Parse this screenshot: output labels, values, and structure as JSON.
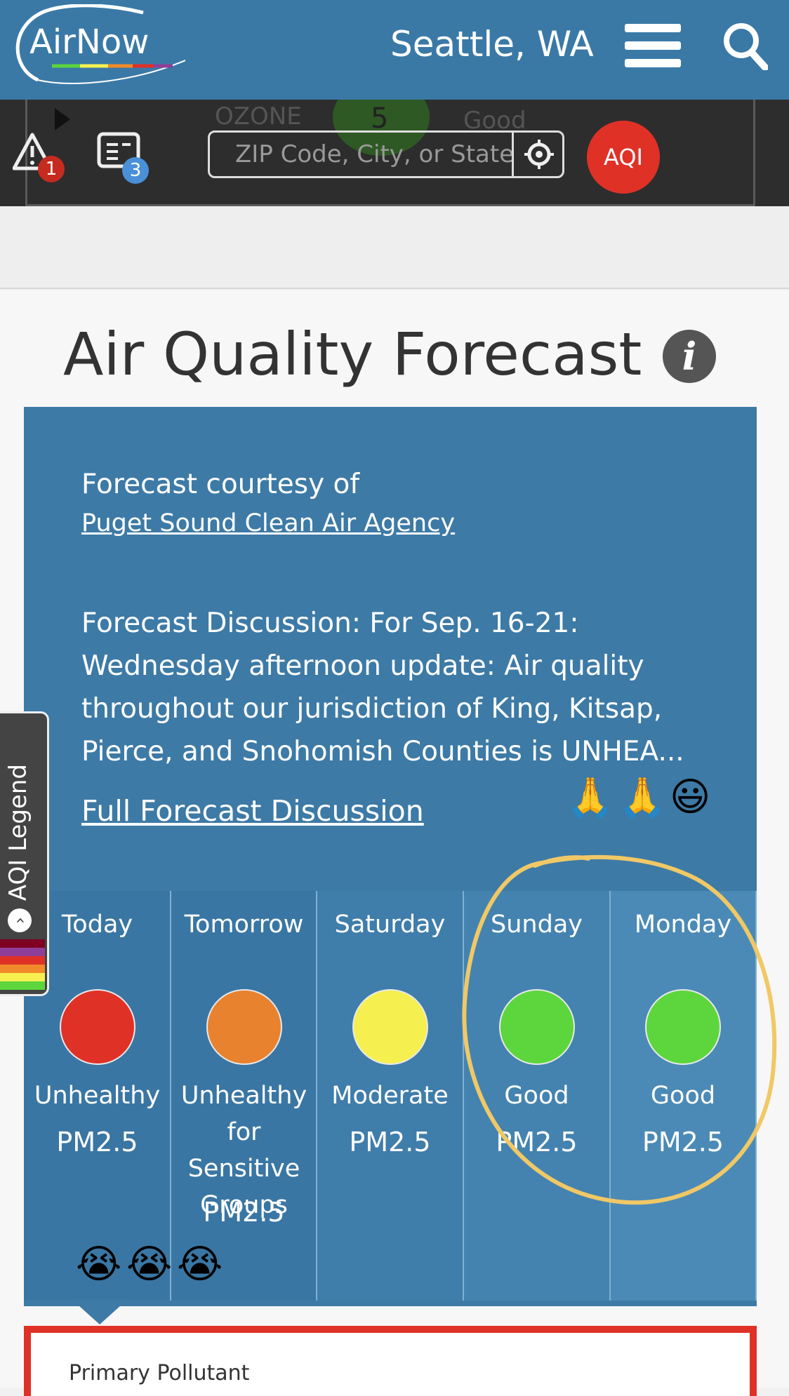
{
  "header": {
    "logo_text": "AirNow",
    "location": "Seattle, WA"
  },
  "toolbar": {
    "ghost_pollutant": "OZONE",
    "ghost_value": "5",
    "ghost_status": "Good",
    "alerts_count": "1",
    "reports_count": "3",
    "search_placeholder": "ZIP Code, City, or State",
    "aqi_button": "AQI"
  },
  "forecast": {
    "title": "Air Quality Forecast",
    "courtesy_label": "Forecast courtesy of",
    "agency_name": "Puget Sound Clean Air Agency",
    "discussion": "Forecast Discussion: For Sep. 16-21: Wednesday afternoon update: Air quality throughout our jurisdiction of King, Kitsap, Pierce, and Snohomish Counties is UNHEA...",
    "full_link": "Full Forecast Discussion",
    "days": [
      {
        "name": "Today",
        "level": "Unhealthy",
        "pollutant": "PM2.5",
        "color": "#e03127"
      },
      {
        "name": "Tomorrow",
        "level": "Unhealthy for Sensitive Groups",
        "pollutant": "PM2.5",
        "color": "#e8822f"
      },
      {
        "name": "Saturday",
        "level": "Moderate",
        "pollutant": "PM2.5",
        "color": "#f5f050"
      },
      {
        "name": "Sunday",
        "level": "Good",
        "pollutant": "PM2.5",
        "color": "#5cd63c"
      },
      {
        "name": "Monday",
        "level": "Good",
        "pollutant": "PM2.5",
        "color": "#5cd63c"
      }
    ],
    "primary_pollutant_label": "Primary Pollutant"
  },
  "legend": {
    "label": "AQI Legend",
    "colors": [
      "#7e0023",
      "#8f3f97",
      "#e03127",
      "#f08a2a",
      "#f7f050",
      "#5cd63c"
    ]
  },
  "annotations": {
    "praying_emoji": "🙏",
    "smile_emoji": "😃",
    "crying_emoji": "😭"
  },
  "colors": {
    "brand_blue": "#3a79a6",
    "panel_blue": "#3d7aa6",
    "toolbar_dark": "#2d2d2d",
    "aqi_red": "#e03127",
    "highlight_circle": "#f0c866"
  }
}
